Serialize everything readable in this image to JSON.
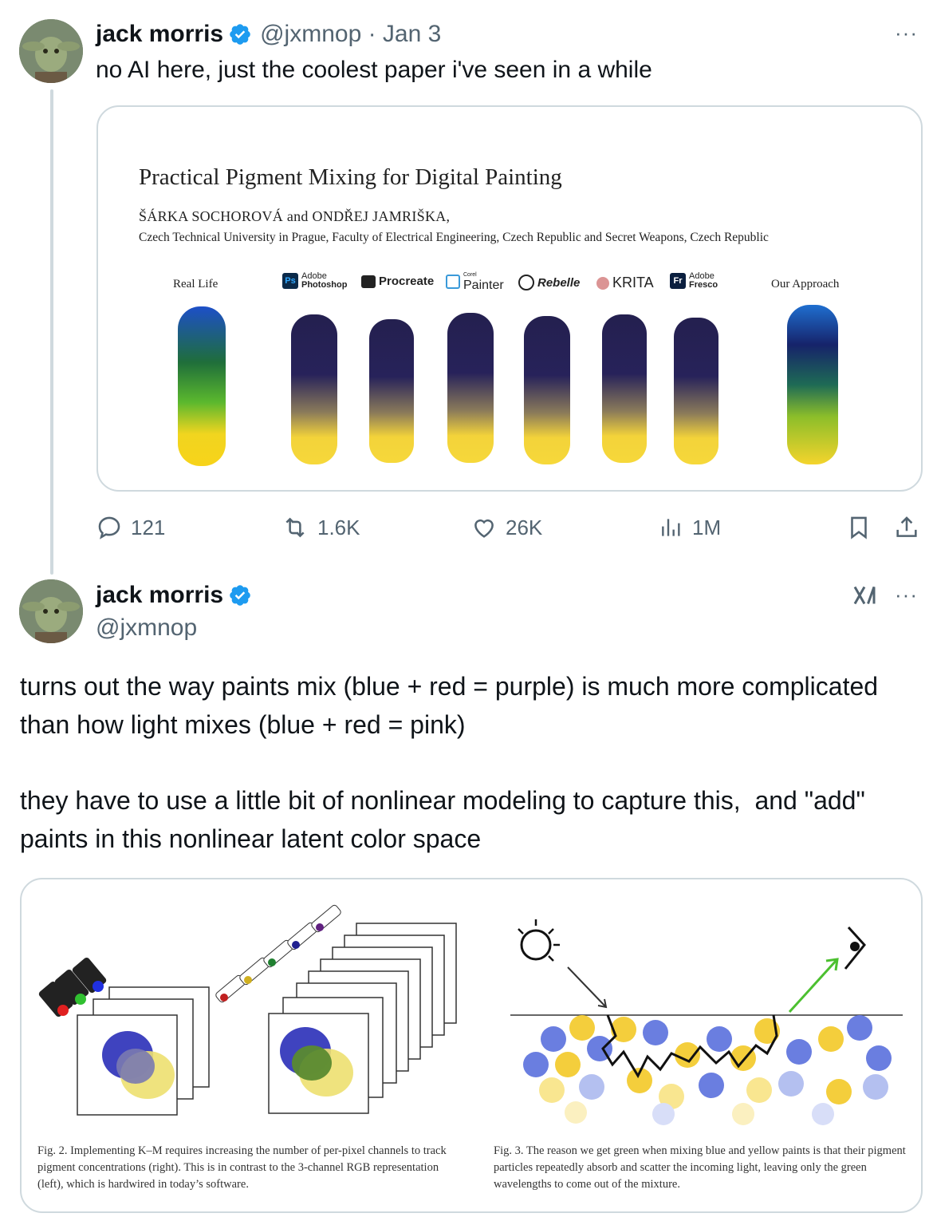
{
  "tweet1": {
    "author_name": "jack morris",
    "handle_date": "@jxmnop · Jan 3",
    "text": "no AI here,  just the coolest paper i've seen in a while",
    "more": "···",
    "image": {
      "title": "Practical Pigment Mixing for Digital Painting",
      "authors": "ŠÁRKA SOCHOROVÁ and ONDŘEJ JAMRIŠKA,",
      "affiliation": "Czech Technical University in Prague, Faculty of Electrical Engineering, Czech Republic and Secret Weapons, Czech Republic",
      "columns": {
        "real_life": "Real Life",
        "photoshop_top": "Adobe",
        "photoshop_bottom": "Photoshop",
        "photoshop_logo": "Ps",
        "procreate": "Procreate",
        "painter_small": "Corel",
        "painter": "Painter",
        "rebelle": "Rebelle",
        "krita": "KRITA",
        "fresco_top": "Adobe",
        "fresco_bottom": "Fresco",
        "fresco_logo": "Fr",
        "our_approach": "Our Approach"
      }
    },
    "actions": {
      "replies": "121",
      "reposts": "1.6K",
      "likes": "26K",
      "views": "1M"
    }
  },
  "tweet2": {
    "author_name": "jack morris",
    "handle": "@jxmnop",
    "more": "···",
    "paragraph1": "turns out the way paints mix (blue + red = purple) is much more complicated than how light mixes (blue + red = pink)",
    "paragraph2": "they have to use a little bit of nonlinear modeling to capture this,  and \"add\" paints in this nonlinear latent color space",
    "image": {
      "caption_left": "Fig. 2.  Implementing K–M requires increasing the number of per-pixel channels to track pigment concentrations (right). This is in contrast to the 3-channel RGB representation (left), which is hardwired in today’s software.",
      "caption_right": "Fig. 3.  The reason we get green when mixing blue and yellow paints is that their pigment particles repeatedly absorb and scatter the incoming light, leaving only the green wavelengths to come out of the mixture."
    }
  }
}
